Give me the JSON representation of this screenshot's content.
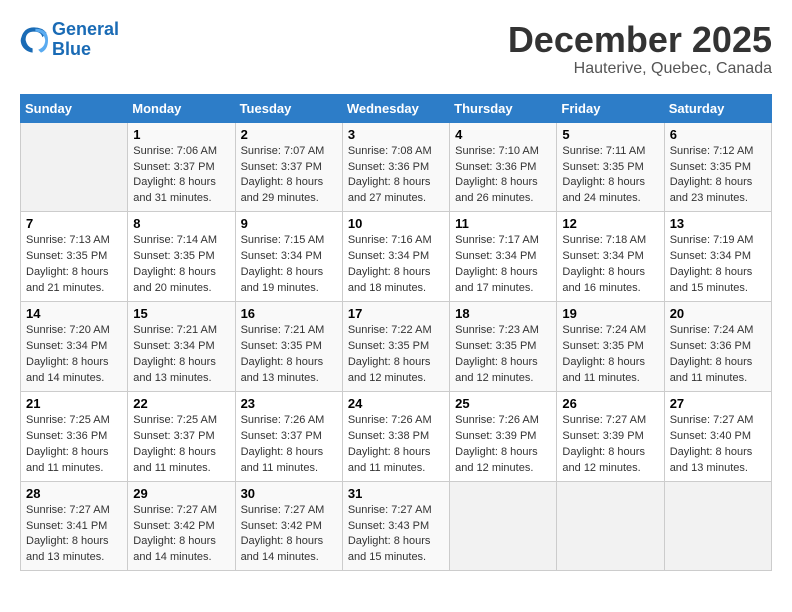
{
  "logo": {
    "line1": "General",
    "line2": "Blue"
  },
  "title": "December 2025",
  "subtitle": "Hauterive, Quebec, Canada",
  "days_of_week": [
    "Sunday",
    "Monday",
    "Tuesday",
    "Wednesday",
    "Thursday",
    "Friday",
    "Saturday"
  ],
  "weeks": [
    [
      {
        "day": "",
        "info": ""
      },
      {
        "day": "1",
        "info": "Sunrise: 7:06 AM\nSunset: 3:37 PM\nDaylight: 8 hours\nand 31 minutes."
      },
      {
        "day": "2",
        "info": "Sunrise: 7:07 AM\nSunset: 3:37 PM\nDaylight: 8 hours\nand 29 minutes."
      },
      {
        "day": "3",
        "info": "Sunrise: 7:08 AM\nSunset: 3:36 PM\nDaylight: 8 hours\nand 27 minutes."
      },
      {
        "day": "4",
        "info": "Sunrise: 7:10 AM\nSunset: 3:36 PM\nDaylight: 8 hours\nand 26 minutes."
      },
      {
        "day": "5",
        "info": "Sunrise: 7:11 AM\nSunset: 3:35 PM\nDaylight: 8 hours\nand 24 minutes."
      },
      {
        "day": "6",
        "info": "Sunrise: 7:12 AM\nSunset: 3:35 PM\nDaylight: 8 hours\nand 23 minutes."
      }
    ],
    [
      {
        "day": "7",
        "info": "Sunrise: 7:13 AM\nSunset: 3:35 PM\nDaylight: 8 hours\nand 21 minutes."
      },
      {
        "day": "8",
        "info": "Sunrise: 7:14 AM\nSunset: 3:35 PM\nDaylight: 8 hours\nand 20 minutes."
      },
      {
        "day": "9",
        "info": "Sunrise: 7:15 AM\nSunset: 3:34 PM\nDaylight: 8 hours\nand 19 minutes."
      },
      {
        "day": "10",
        "info": "Sunrise: 7:16 AM\nSunset: 3:34 PM\nDaylight: 8 hours\nand 18 minutes."
      },
      {
        "day": "11",
        "info": "Sunrise: 7:17 AM\nSunset: 3:34 PM\nDaylight: 8 hours\nand 17 minutes."
      },
      {
        "day": "12",
        "info": "Sunrise: 7:18 AM\nSunset: 3:34 PM\nDaylight: 8 hours\nand 16 minutes."
      },
      {
        "day": "13",
        "info": "Sunrise: 7:19 AM\nSunset: 3:34 PM\nDaylight: 8 hours\nand 15 minutes."
      }
    ],
    [
      {
        "day": "14",
        "info": "Sunrise: 7:20 AM\nSunset: 3:34 PM\nDaylight: 8 hours\nand 14 minutes."
      },
      {
        "day": "15",
        "info": "Sunrise: 7:21 AM\nSunset: 3:34 PM\nDaylight: 8 hours\nand 13 minutes."
      },
      {
        "day": "16",
        "info": "Sunrise: 7:21 AM\nSunset: 3:35 PM\nDaylight: 8 hours\nand 13 minutes."
      },
      {
        "day": "17",
        "info": "Sunrise: 7:22 AM\nSunset: 3:35 PM\nDaylight: 8 hours\nand 12 minutes."
      },
      {
        "day": "18",
        "info": "Sunrise: 7:23 AM\nSunset: 3:35 PM\nDaylight: 8 hours\nand 12 minutes."
      },
      {
        "day": "19",
        "info": "Sunrise: 7:24 AM\nSunset: 3:35 PM\nDaylight: 8 hours\nand 11 minutes."
      },
      {
        "day": "20",
        "info": "Sunrise: 7:24 AM\nSunset: 3:36 PM\nDaylight: 8 hours\nand 11 minutes."
      }
    ],
    [
      {
        "day": "21",
        "info": "Sunrise: 7:25 AM\nSunset: 3:36 PM\nDaylight: 8 hours\nand 11 minutes."
      },
      {
        "day": "22",
        "info": "Sunrise: 7:25 AM\nSunset: 3:37 PM\nDaylight: 8 hours\nand 11 minutes."
      },
      {
        "day": "23",
        "info": "Sunrise: 7:26 AM\nSunset: 3:37 PM\nDaylight: 8 hours\nand 11 minutes."
      },
      {
        "day": "24",
        "info": "Sunrise: 7:26 AM\nSunset: 3:38 PM\nDaylight: 8 hours\nand 11 minutes."
      },
      {
        "day": "25",
        "info": "Sunrise: 7:26 AM\nSunset: 3:39 PM\nDaylight: 8 hours\nand 12 minutes."
      },
      {
        "day": "26",
        "info": "Sunrise: 7:27 AM\nSunset: 3:39 PM\nDaylight: 8 hours\nand 12 minutes."
      },
      {
        "day": "27",
        "info": "Sunrise: 7:27 AM\nSunset: 3:40 PM\nDaylight: 8 hours\nand 13 minutes."
      }
    ],
    [
      {
        "day": "28",
        "info": "Sunrise: 7:27 AM\nSunset: 3:41 PM\nDaylight: 8 hours\nand 13 minutes."
      },
      {
        "day": "29",
        "info": "Sunrise: 7:27 AM\nSunset: 3:42 PM\nDaylight: 8 hours\nand 14 minutes."
      },
      {
        "day": "30",
        "info": "Sunrise: 7:27 AM\nSunset: 3:42 PM\nDaylight: 8 hours\nand 14 minutes."
      },
      {
        "day": "31",
        "info": "Sunrise: 7:27 AM\nSunset: 3:43 PM\nDaylight: 8 hours\nand 15 minutes."
      },
      {
        "day": "",
        "info": ""
      },
      {
        "day": "",
        "info": ""
      },
      {
        "day": "",
        "info": ""
      }
    ]
  ]
}
